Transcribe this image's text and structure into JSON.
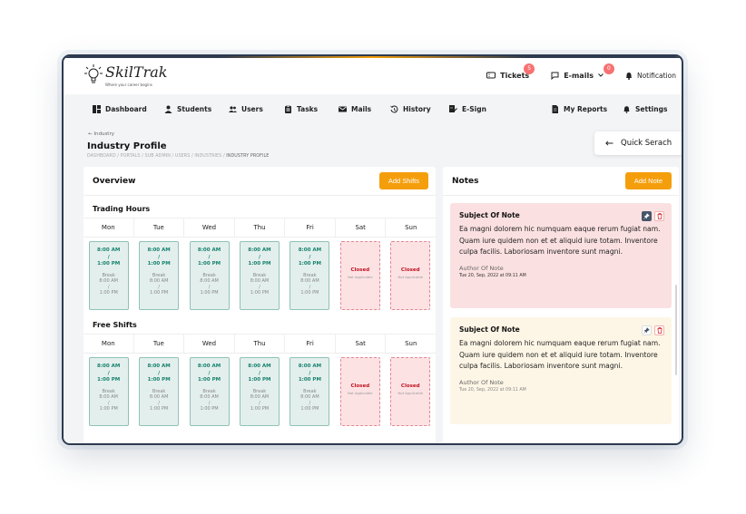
{
  "logo": {
    "brand": "SkilTrak",
    "tagline": "Where your career begins"
  },
  "top": {
    "tickets": {
      "label": "Tickets",
      "count": "5"
    },
    "emails": {
      "label": "E-mails",
      "count": "0"
    },
    "notification": "Notification"
  },
  "nav": {
    "dashboard": "Dashboard",
    "students": "Students",
    "users": "Users",
    "tasks": "Tasks",
    "mails": "Mails",
    "history": "History",
    "esign": "E-Sign",
    "reports": "My Reports",
    "settings": "Settings"
  },
  "page": {
    "back": "Industry",
    "title": "Industry Profile",
    "breadcrumb": [
      "DASHBOARD",
      "PORTALS",
      "SUB ADMIN",
      "USERS",
      "INDUSTRIES",
      "INDUSTRY PROFILE"
    ],
    "quick_search": "Quick Serach"
  },
  "overview": {
    "title": "Overview",
    "add_shifts": "Add Shifts",
    "days": [
      "Mon",
      "Tue",
      "Wed",
      "Thu",
      "Fri",
      "Sat",
      "Sun"
    ],
    "shift": {
      "start": "8:00 AM",
      "slash": "/",
      "end": "1:00 PM",
      "break_label": "Break",
      "break_start": "8:00 AM",
      "break_end": "1:00 PM"
    },
    "closed": {
      "label": "Closed",
      "sub": "Not Applicable"
    },
    "sections": {
      "trading": "Trading Hours",
      "free": "Free Shifts"
    }
  },
  "notes": {
    "title": "Notes",
    "add_note": "Add Note",
    "items": [
      {
        "subject": "Subject Of Note",
        "body": "Ea magni dolorem hic numquam eaque rerum fugiat nam. Quam iure quidem non et et aliquid iure totam. Inventore culpa facilis. Laboriosam inventore sunt magni.",
        "author": "Author Of Note",
        "date": "Tue 20, Sep, 2022 at 09:11 AM",
        "color": "#fbe0e1"
      },
      {
        "subject": "Subject Of Note",
        "body": "Ea magni dolorem hic numquam eaque rerum fugiat nam. Quam iure quidem non et et aliquid iure totam. Inventore culpa facilis. Laboriosam inventore sunt magni.",
        "author": "Author Of Note",
        "date": "Tue 20, Sep, 2022 at 09:11 AM",
        "color": "#fdf6e6"
      }
    ]
  },
  "colors": {
    "accent": "#f59e0b",
    "open_time": "#16826e",
    "closed": "#c1121f"
  }
}
